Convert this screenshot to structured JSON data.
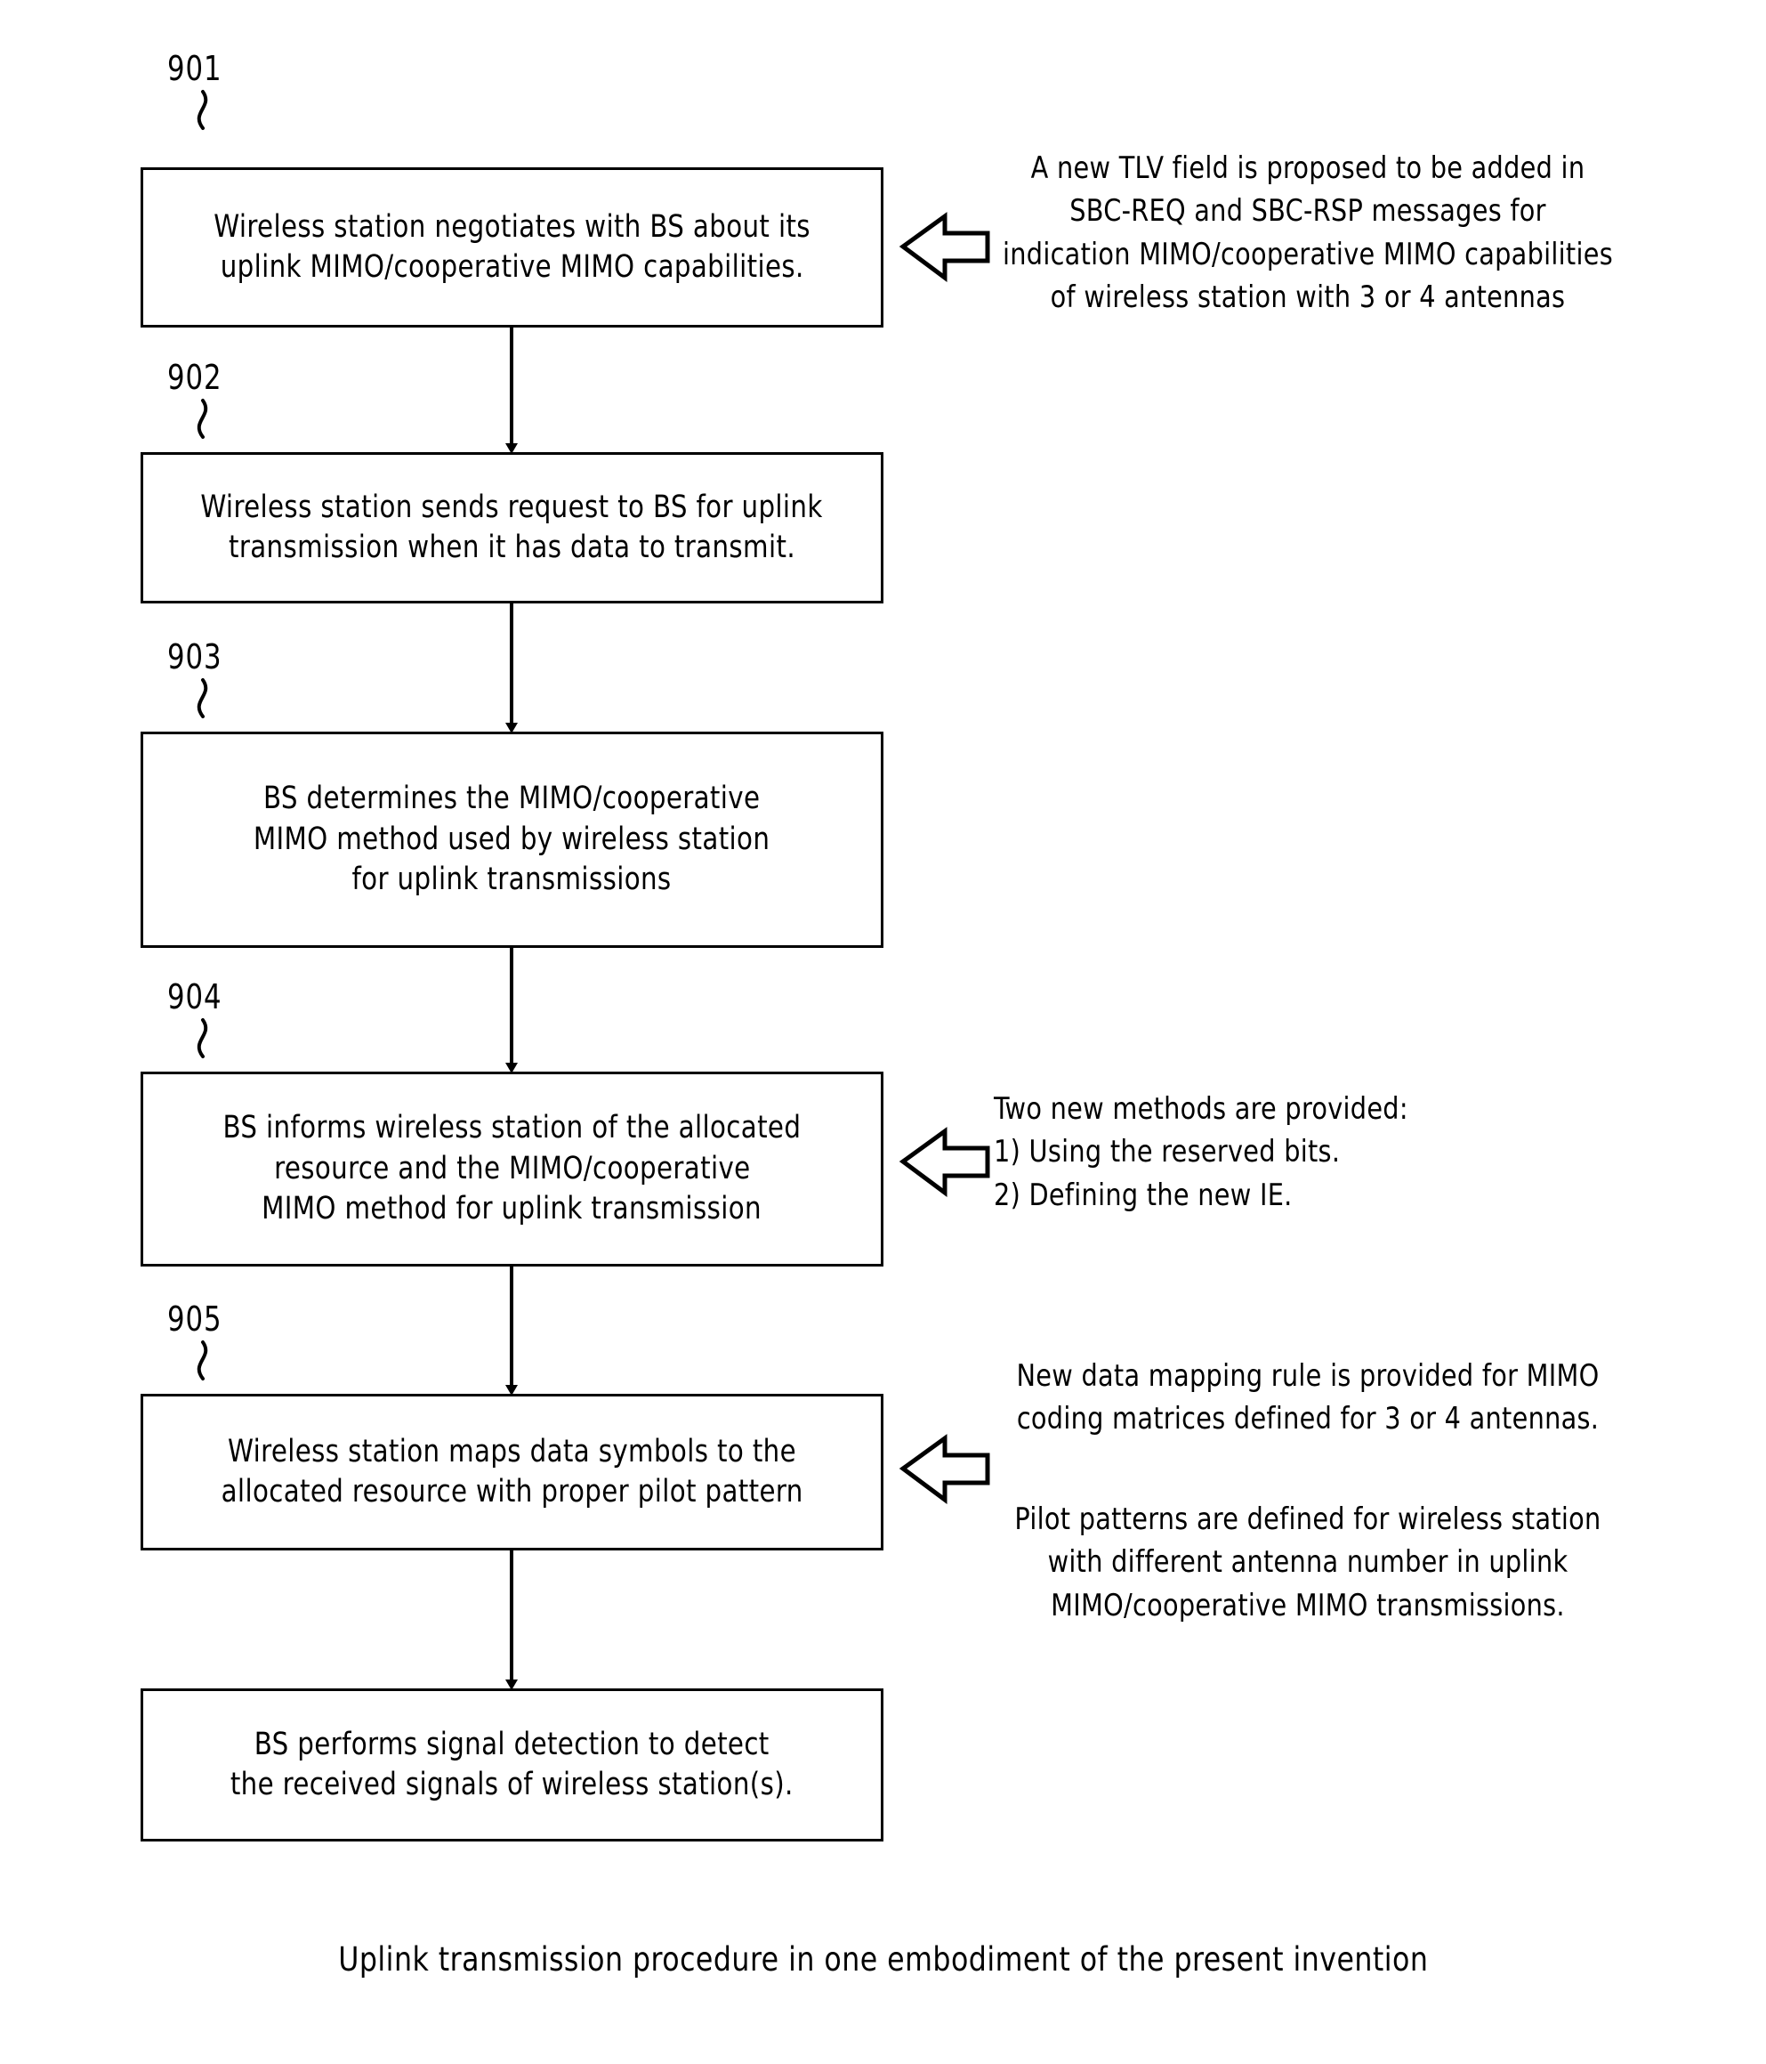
{
  "figure": {
    "caption": "Uplink transmission procedure in one embodiment of the present invention"
  },
  "steps": [
    {
      "ref": "901",
      "lines": [
        "Wireless station negotiates with BS about its",
        "uplink MIMO/cooperative MIMO capabilities."
      ]
    },
    {
      "ref": "902",
      "lines": [
        "Wireless station sends request to BS for uplink",
        "transmission when it has data to transmit."
      ]
    },
    {
      "ref": "903",
      "lines": [
        "BS determines the MIMO/cooperative",
        "MIMO method used by wireless station",
        "for uplink transmissions"
      ]
    },
    {
      "ref": "904",
      "lines": [
        "BS informs wireless station of the allocated",
        "resource and the MIMO/cooperative",
        "MIMO method for uplink transmission"
      ]
    },
    {
      "ref": "905",
      "lines": [
        "Wireless station maps data symbols to the",
        "allocated resource with proper pilot pattern"
      ]
    },
    {
      "ref": "",
      "lines": [
        "BS performs signal detection to detect",
        "the received signals of wireless station(s)."
      ]
    }
  ],
  "annotations": [
    {
      "id": "annotation-tlv",
      "lines": [
        "A new TLV field is proposed to be added in",
        "SBC-REQ and SBC-RSP messages for",
        "indication MIMO/cooperative MIMO capabilities",
        "of wireless station with 3 or 4 antennas"
      ]
    },
    {
      "id": "annotation-methods",
      "lines": [
        "Two new methods are provided:",
        "1) Using the reserved bits.",
        "2) Defining the new IE."
      ]
    },
    {
      "id": "annotation-mapping",
      "lines": [
        "New data mapping rule is provided for MIMO",
        "coding matrices defined for 3 or 4 antennas."
      ]
    },
    {
      "id": "annotation-pilot",
      "lines": [
        "Pilot patterns are defined for wireless station",
        "with different antenna number in uplink",
        "MIMO/cooperative MIMO transmissions."
      ]
    }
  ],
  "colors": {
    "ink": "#000000",
    "paper": "#ffffff"
  }
}
